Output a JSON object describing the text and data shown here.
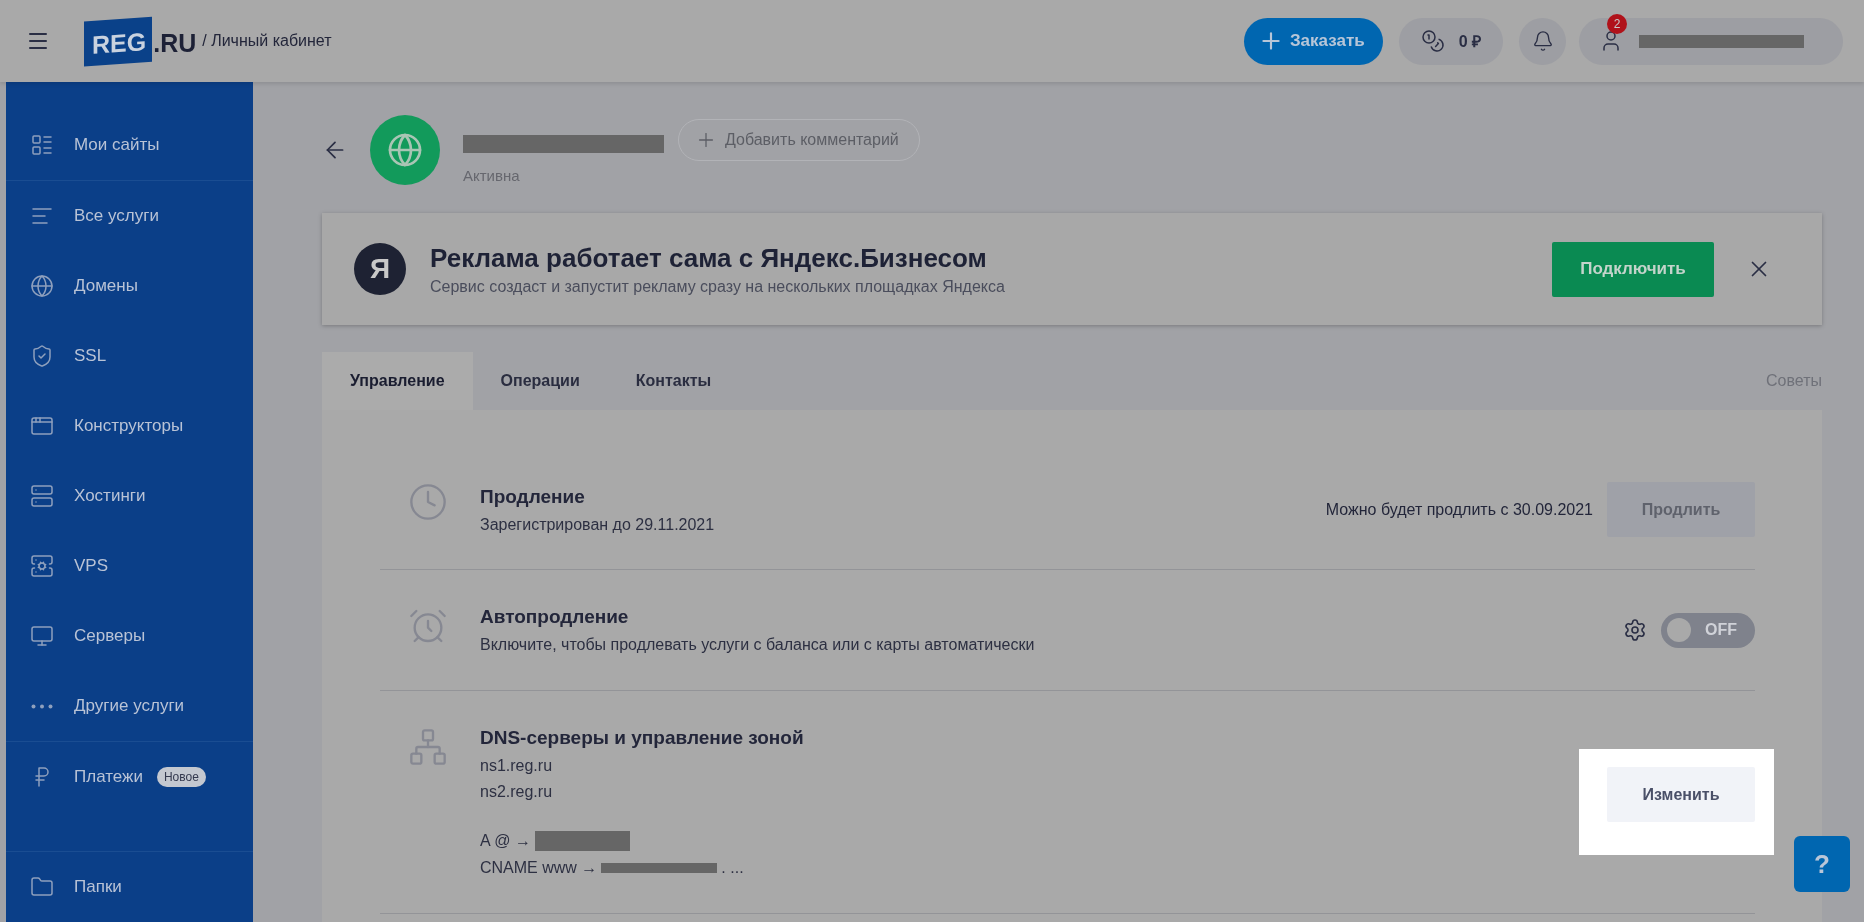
{
  "header": {
    "breadcrumb": "/ Личный кабинет",
    "logo": {
      "main": "REG",
      "suffix": ".RU"
    },
    "order_button": "Заказать",
    "balance": "0 ₽",
    "notifications_badge": "2",
    "account": {
      "email_redacted": true
    }
  },
  "sidebar": {
    "items": [
      {
        "label": "Мои сайты",
        "selected": false
      },
      {
        "label": "Все услуги",
        "selected": false
      },
      {
        "label": "Домены",
        "selected": false
      },
      {
        "label": "SSL",
        "selected": false
      },
      {
        "label": "Конструкторы",
        "selected": false
      },
      {
        "label": "Хостинги",
        "selected": false
      },
      {
        "label": "VPS",
        "selected": false
      },
      {
        "label": "Серверы",
        "selected": false
      },
      {
        "label": "Другие услуги",
        "selected": false
      },
      {
        "label": "Платежи",
        "badge": "Новое",
        "selected": false
      }
    ],
    "bottom_item": {
      "label": "Папки",
      "selected": false
    }
  },
  "service": {
    "name_redacted": true,
    "status": "Активна",
    "add_comment": "Добавить комментарий"
  },
  "banner": {
    "logo_letter": "Я",
    "title": "Реклама работает сама с Яндекс.Бизнесом",
    "subtitle": "Сервис создаст и запустит рекламу сразу на нескольких площадках Яндекса",
    "button": "Подключить"
  },
  "tabs": [
    {
      "label": "Управление",
      "selected": true
    },
    {
      "label": "Операции",
      "selected": false
    },
    {
      "label": "Контакты",
      "selected": false
    }
  ],
  "tips_link": "Советы",
  "sections": [
    {
      "kind": "renewal",
      "title": "Продление",
      "subtitle": "Зарегистрирован до 29.11.2021",
      "note": "Можно будет продлить с 30.09.2021",
      "button": "Продлить",
      "disabled": true
    },
    {
      "kind": "autorenew",
      "title": "Автопродление",
      "subtitle": "Включите, чтобы продлевать услуги с баланса или с карты автоматически",
      "toggle": {
        "on": false,
        "label": "OFF"
      }
    },
    {
      "kind": "dns",
      "title": "DNS-серверы и управление зоной",
      "servers": [
        "ns1.reg.ru",
        "ns2.reg.ru"
      ],
      "records": [
        {
          "prefix": "A @ →",
          "redacted": true
        },
        {
          "prefix": "CNAME www →",
          "redacted": true,
          "suffix": ". ..."
        }
      ],
      "button": "Изменить",
      "highlighted": true
    }
  ],
  "help_button": "?"
}
